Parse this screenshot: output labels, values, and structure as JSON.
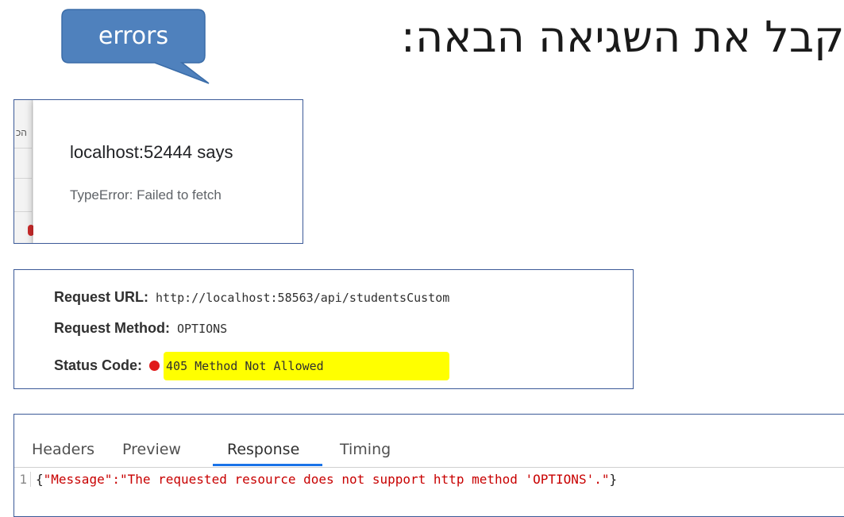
{
  "slide": {
    "title": "נקבל את השגיאה הבאה:"
  },
  "callout": {
    "label": "errors",
    "fill_color": "#4f81bd",
    "border_color": "#3a6ca8"
  },
  "dialog": {
    "background_fragment": "הכ",
    "heading": "localhost:52444 says",
    "message": "TypeError: Failed to fetch"
  },
  "request": {
    "url_label": "Request URL:",
    "url_value": "http://localhost:58563/api/studentsCustom",
    "method_label": "Request Method:",
    "method_value": "OPTIONS",
    "status_label": "Status Code:",
    "status_value": "405 Method Not Allowed",
    "status_color": "#e01b1b",
    "highlight_color": "#ffff00"
  },
  "devtools": {
    "tabs": [
      {
        "label": "Headers",
        "active": false
      },
      {
        "label": "Preview",
        "active": false
      },
      {
        "label": "Response",
        "active": true
      },
      {
        "label": "Timing",
        "active": false
      }
    ],
    "line_number": "1",
    "brace_open": "{",
    "response_text": "\"Message\":\"The requested resource does not support http method 'OPTIONS'.\"",
    "brace_close": "}",
    "accent_color": "#1a73e8"
  }
}
